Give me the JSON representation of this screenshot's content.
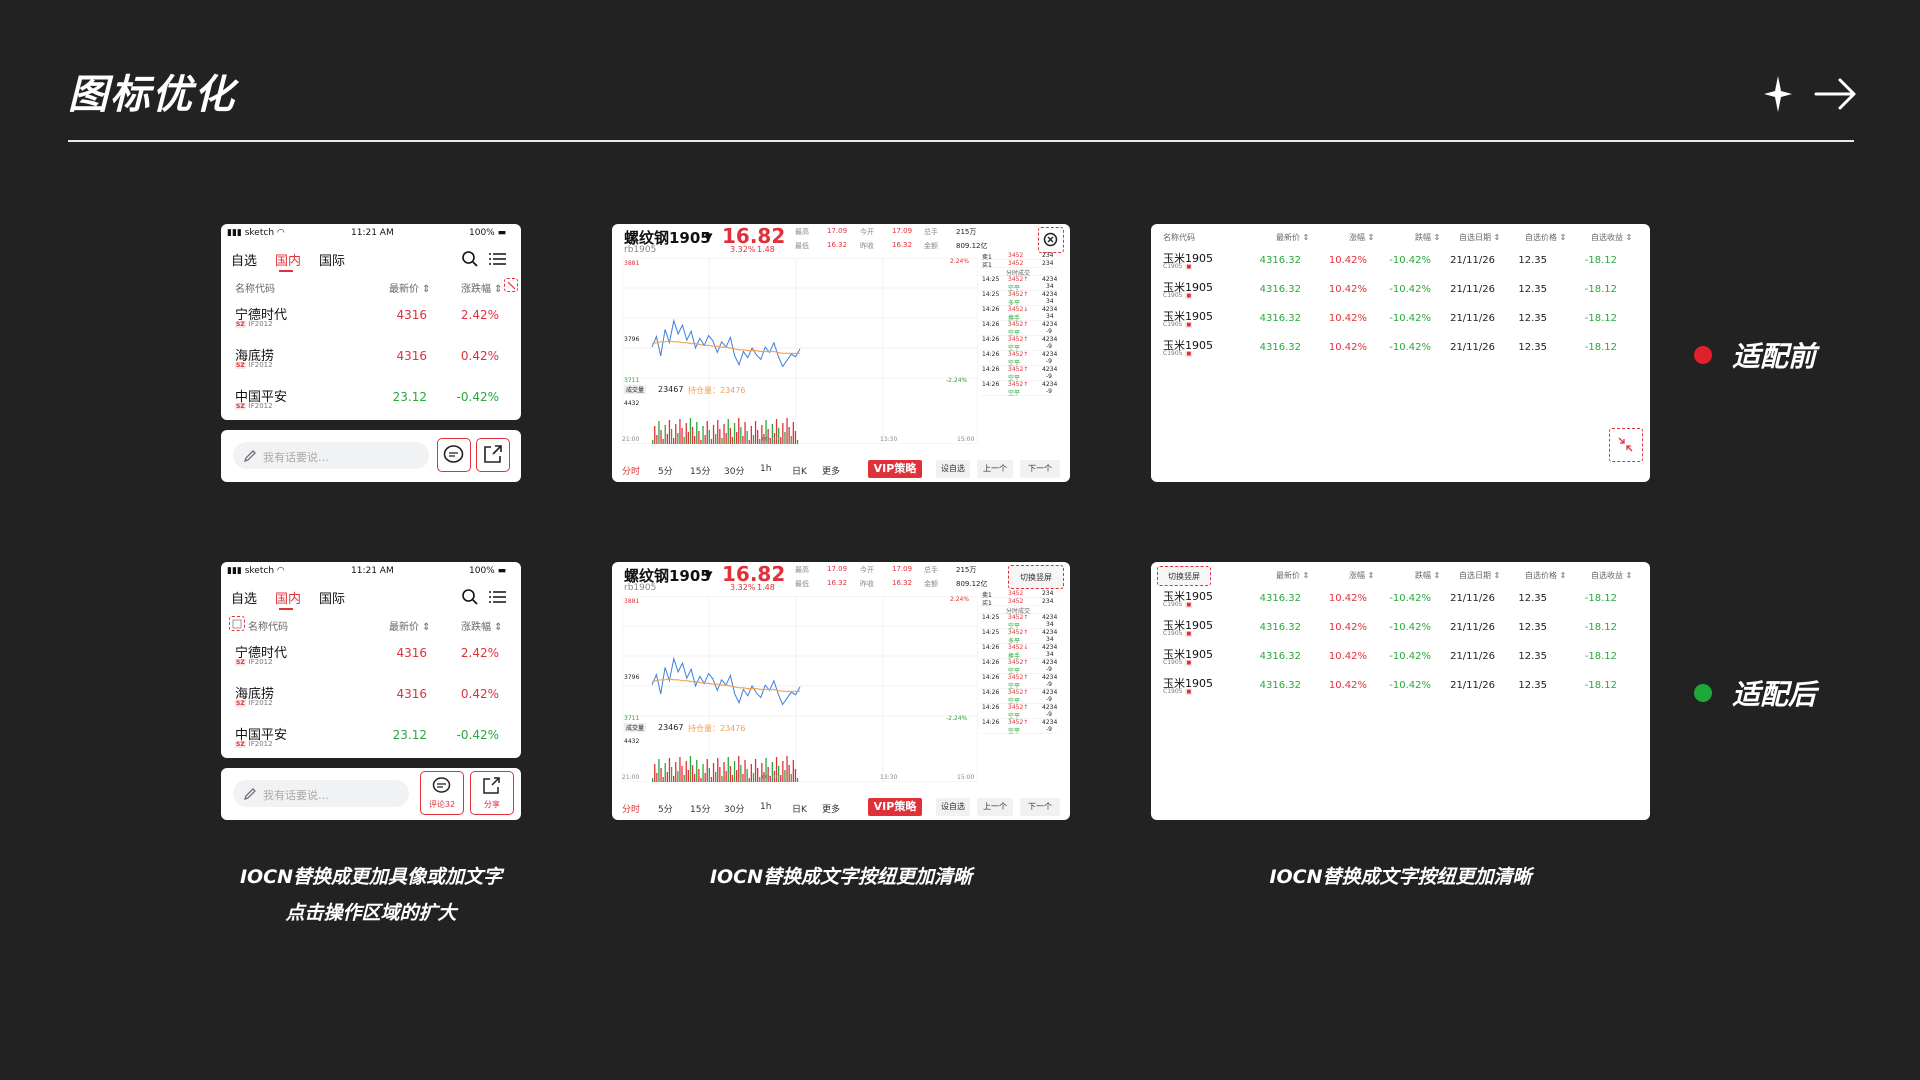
{
  "slide": {
    "title": "图标优化",
    "legend_before": "适配前",
    "legend_after": "适配后",
    "colors": {
      "before_dot": "#e0202c",
      "after_dot": "#1fa83a",
      "accent": "#e0313a",
      "rise": "#e0313a",
      "fall": "#29a83b"
    },
    "decoration_icons": [
      "sparkle-icon",
      "arrow-right-icon"
    ]
  },
  "captions": {
    "col1_line1": "IOCN替换成更加具像或加文字",
    "col1_line2": "点击操作区域的扩大",
    "col2": "IOCN替换成文字按纽更加清晰",
    "col3": "IOCN替换成文字按纽更加清晰"
  },
  "phone": {
    "status": {
      "carrier": "sketch",
      "time": "11:21 AM",
      "battery": "100%"
    },
    "tabs": [
      "自选",
      "国内",
      "国际"
    ],
    "active_tab": "国内",
    "headers": {
      "name": "名称代码",
      "price": "最新价",
      "change": "涨跌幅"
    },
    "rows": [
      {
        "name": "宁德时代",
        "market": "SZ",
        "code": "IF2012",
        "price": "4316",
        "change": "2.42%",
        "trend": "up"
      },
      {
        "name": "海底捞",
        "market": "SZ",
        "code": "IF2012",
        "price": "4316",
        "change": "0.42%",
        "trend": "up"
      },
      {
        "name": "中国平安",
        "market": "SZ",
        "code": "IF2012",
        "price": "23.12",
        "change": "-0.42%",
        "trend": "down"
      }
    ],
    "input_placeholder": "我有话要说…",
    "after_buttons": {
      "comment": "评论32",
      "share": "分享"
    }
  },
  "quote": {
    "name": "螺纹钢1905",
    "code": "rb1905",
    "price": "16.82",
    "pct": "3.32%",
    "delta": "1.48",
    "stats": {
      "high_label": "最高",
      "high": "17.09",
      "open_label": "今开",
      "open": "17.09",
      "hand_label": "总手",
      "hand": "215万",
      "low_label": "最低",
      "low": "16.32",
      "prev_label": "昨收",
      "prev": "16.32",
      "amount_label": "金额",
      "amount": "809.12亿"
    },
    "axis": {
      "top": "3881",
      "mid": "3796",
      "bottom": "3711",
      "pct_top": "2.24%",
      "pct_bottom": "-2.24%",
      "vol": "4432"
    },
    "volume_label": "成交量",
    "volume": "23467",
    "open_interest": "持仓量：23476",
    "time_axis": [
      "21:00",
      "09:00",
      "13:30",
      "15:00"
    ],
    "book_header": "分时成交",
    "book": [
      {
        "label": "卖1",
        "price": "3452",
        "vol": "234"
      },
      {
        "label": "买1",
        "price": "3452",
        "vol": "234"
      }
    ],
    "ticks": [
      {
        "t": "14:25",
        "p": "3452↑",
        "v": "4234",
        "s": "空平",
        "d": "34"
      },
      {
        "t": "14:25",
        "p": "3452↑",
        "v": "4234",
        "s": "多平",
        "d": "34"
      },
      {
        "t": "14:26",
        "p": "3452↓",
        "v": "4234",
        "s": "换手",
        "d": "34"
      },
      {
        "t": "14:26",
        "p": "3452↑",
        "v": "4234",
        "s": "空平",
        "d": "-9"
      },
      {
        "t": "14:26",
        "p": "3452↑",
        "v": "4234",
        "s": "空平",
        "d": "-9"
      },
      {
        "t": "14:26",
        "p": "3452↑",
        "v": "4234",
        "s": "空平",
        "d": "-9"
      },
      {
        "t": "14:26",
        "p": "3452↑",
        "v": "4234",
        "s": "空平",
        "d": "-9"
      },
      {
        "t": "14:26",
        "p": "3452↑",
        "v": "4234",
        "s": "空平",
        "d": "-9"
      }
    ],
    "periods": [
      "分时",
      "5分",
      "15分",
      "30分",
      "1h",
      "日K",
      "更多"
    ],
    "vip_label": "VIP策略",
    "btn_watch": "设自选",
    "btn_prev": "上一个",
    "btn_next": "下一个",
    "switch_label": "切换竖屏",
    "chart_data": {
      "type": "line",
      "y_range": [
        3711,
        3881
      ],
      "series": [
        {
          "values": [
            3780,
            3792,
            3770,
            3800,
            3785,
            3810,
            3795,
            3805,
            3788,
            3798,
            3779,
            3790,
            3782,
            3793,
            3787,
            3774,
            3786,
            3780,
            3791,
            3770,
            3760,
            3775,
            3768,
            3779,
            3771,
            3766,
            3780,
            3774,
            3785,
            3770,
            3758,
            3765,
            3772,
            3769,
            3778
          ]
        },
        {
          "values": [
            3784,
            3785,
            3786,
            3786,
            3787,
            3786,
            3786,
            3785,
            3785,
            3784,
            3784,
            3783,
            3782,
            3782,
            3781,
            3781,
            3780,
            3780,
            3779,
            3778,
            3777,
            3777,
            3776,
            3776,
            3776,
            3775,
            3775,
            3775,
            3775,
            3774,
            3773,
            3773,
            3773,
            3773,
            3773
          ]
        }
      ]
    }
  },
  "table": {
    "headers": [
      "名称代码",
      "最新价",
      "涨幅",
      "跌幅",
      "自选日期",
      "自选价格",
      "自选收益"
    ],
    "rows": [
      {
        "name": "玉米1905",
        "code": "C1905",
        "price": "4316.32",
        "up": "10.42%",
        "down": "-10.42%",
        "date": "21/11/26",
        "cost": "12.35",
        "ret": "-18.12"
      },
      {
        "name": "玉米1905",
        "code": "C1905",
        "price": "4316.32",
        "up": "10.42%",
        "down": "-10.42%",
        "date": "21/11/26",
        "cost": "12.35",
        "ret": "-18.12"
      },
      {
        "name": "玉米1905",
        "code": "C1905",
        "price": "4316.32",
        "up": "10.42%",
        "down": "-10.42%",
        "date": "21/11/26",
        "cost": "12.35",
        "ret": "-18.12"
      },
      {
        "name": "玉米1905",
        "code": "C1905",
        "price": "4316.32",
        "up": "10.42%",
        "down": "-10.42%",
        "date": "21/11/26",
        "cost": "12.35",
        "ret": "-18.12"
      }
    ],
    "switch_label": "切换竖屏"
  }
}
